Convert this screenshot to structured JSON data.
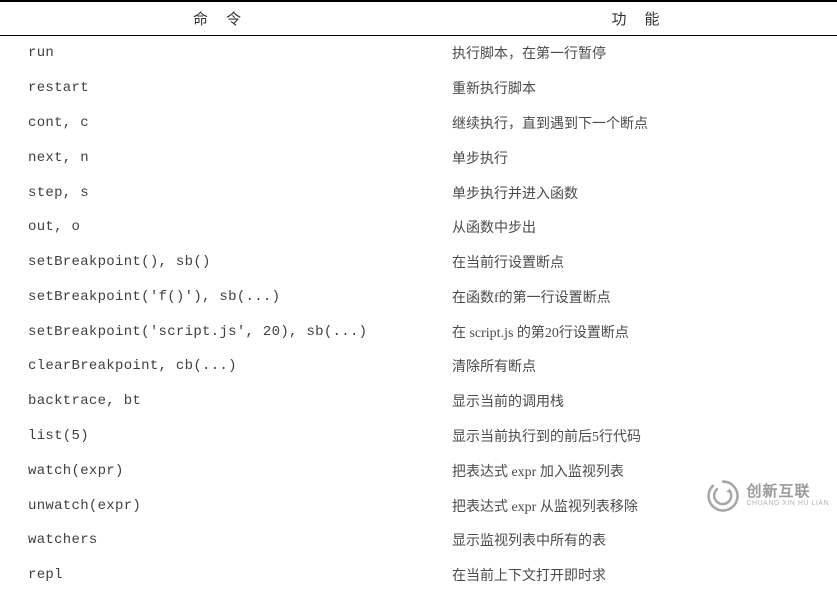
{
  "headers": {
    "command": "命令",
    "function": "功能"
  },
  "rows": [
    {
      "cmd": "run",
      "func": "执行脚本，在第一行暂停"
    },
    {
      "cmd": "restart",
      "func": "重新执行脚本"
    },
    {
      "cmd": "cont, c",
      "func": "继续执行，直到遇到下一个断点"
    },
    {
      "cmd": "next, n",
      "func": "单步执行"
    },
    {
      "cmd": "step, s",
      "func": "单步执行并进入函数"
    },
    {
      "cmd": "out, o",
      "func": "从函数中步出"
    },
    {
      "cmd": "setBreakpoint(), sb()",
      "func": "在当前行设置断点"
    },
    {
      "cmd": "setBreakpoint('f()'), sb(...)",
      "func": "在函数f的第一行设置断点"
    },
    {
      "cmd": "setBreakpoint('script.js', 20), sb(...)",
      "func": "在 script.js 的第20行设置断点"
    },
    {
      "cmd": "clearBreakpoint, cb(...)",
      "func": "清除所有断点"
    },
    {
      "cmd": "backtrace, bt",
      "func": "显示当前的调用栈"
    },
    {
      "cmd": "list(5)",
      "func": "显示当前执行到的前后5行代码"
    },
    {
      "cmd": "watch(expr)",
      "func": "把表达式 expr 加入监视列表"
    },
    {
      "cmd": "unwatch(expr)",
      "func": "把表达式 expr 从监视列表移除"
    },
    {
      "cmd": "watchers",
      "func": "显示监视列表中所有的表"
    },
    {
      "cmd": "repl",
      "func": "在当前上下文打开即时求"
    }
  ],
  "watermark": {
    "brand": "创新互联",
    "pinyin": "CHUANG XIN HU LIAN"
  }
}
